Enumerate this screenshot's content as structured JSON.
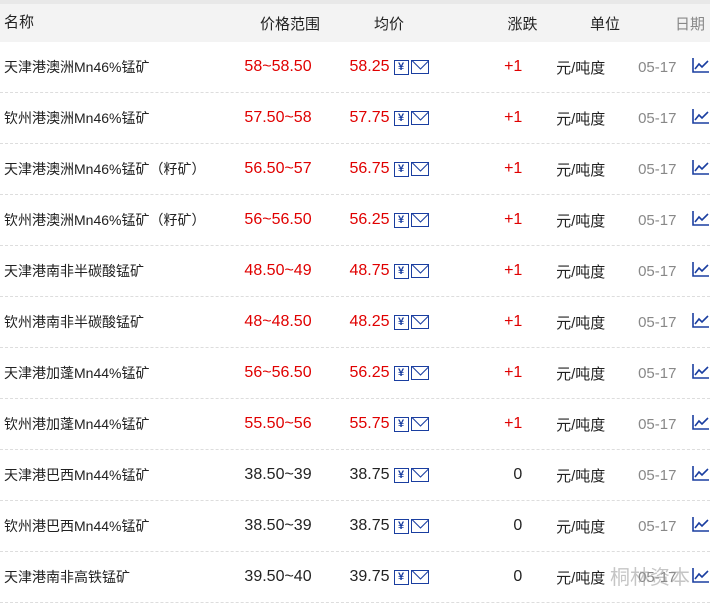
{
  "header": {
    "name": "名称",
    "range": "价格范围",
    "avg": "均价",
    "change": "涨跌",
    "unit": "单位",
    "date": "日期"
  },
  "colors": {
    "up": "#e00000",
    "flat": "#222222",
    "icon": "#1a3ea0"
  },
  "rows": [
    {
      "name": "天津港澳洲Mn46%锰矿",
      "range": "58~58.50",
      "avg": "58.25",
      "change": "+1",
      "unit": "元/吨度",
      "date": "05-17",
      "up": true
    },
    {
      "name": "钦州港澳洲Mn46%锰矿",
      "range": "57.50~58",
      "avg": "57.75",
      "change": "+1",
      "unit": "元/吨度",
      "date": "05-17",
      "up": true
    },
    {
      "name": "天津港澳洲Mn46%锰矿（籽矿）",
      "range": "56.50~57",
      "avg": "56.75",
      "change": "+1",
      "unit": "元/吨度",
      "date": "05-17",
      "up": true
    },
    {
      "name": "钦州港澳洲Mn46%锰矿（籽矿）",
      "range": "56~56.50",
      "avg": "56.25",
      "change": "+1",
      "unit": "元/吨度",
      "date": "05-17",
      "up": true
    },
    {
      "name": "天津港南非半碳酸锰矿",
      "range": "48.50~49",
      "avg": "48.75",
      "change": "+1",
      "unit": "元/吨度",
      "date": "05-17",
      "up": true
    },
    {
      "name": "钦州港南非半碳酸锰矿",
      "range": "48~48.50",
      "avg": "48.25",
      "change": "+1",
      "unit": "元/吨度",
      "date": "05-17",
      "up": true
    },
    {
      "name": "天津港加蓬Mn44%锰矿",
      "range": "56~56.50",
      "avg": "56.25",
      "change": "+1",
      "unit": "元/吨度",
      "date": "05-17",
      "up": true
    },
    {
      "name": "钦州港加蓬Mn44%锰矿",
      "range": "55.50~56",
      "avg": "55.75",
      "change": "+1",
      "unit": "元/吨度",
      "date": "05-17",
      "up": true
    },
    {
      "name": "天津港巴西Mn44%锰矿",
      "range": "38.50~39",
      "avg": "38.75",
      "change": "0",
      "unit": "元/吨度",
      "date": "05-17",
      "up": false
    },
    {
      "name": "钦州港巴西Mn44%锰矿",
      "range": "38.50~39",
      "avg": "38.75",
      "change": "0",
      "unit": "元/吨度",
      "date": "05-17",
      "up": false
    },
    {
      "name": "天津港南非高铁锰矿",
      "range": "39.50~40",
      "avg": "39.75",
      "change": "0",
      "unit": "元/吨度",
      "date": "05-17",
      "up": false
    }
  ],
  "icons": {
    "calc": "yuan-icon",
    "mail": "mail-icon",
    "chart": "trend-chart-icon",
    "yuan_glyph": "¥"
  },
  "watermark": "桐林资本"
}
